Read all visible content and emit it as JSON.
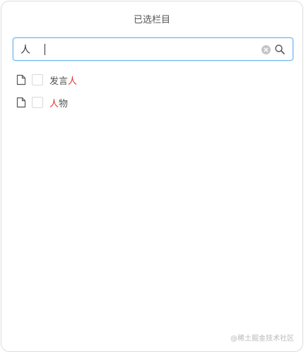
{
  "panel": {
    "title": "已选栏目"
  },
  "search": {
    "value": "人",
    "placeholder": ""
  },
  "icons": {
    "clear": "clear-circle-icon",
    "search": "search-icon",
    "file": "file-icon"
  },
  "results": [
    {
      "prefix": "发言",
      "match": "人",
      "suffix": "",
      "checked": false
    },
    {
      "prefix": "",
      "match": "人",
      "suffix": "物",
      "checked": false
    }
  ],
  "watermark": "@稀土掘金技术社区",
  "colors": {
    "highlight": "#e5312d",
    "focus_border": "#6cb6f3"
  }
}
